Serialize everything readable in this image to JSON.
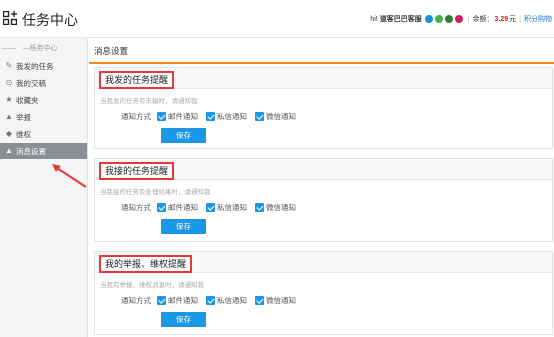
{
  "header": {
    "title": "任务中心",
    "greeting": "hi!",
    "username": "道客巴巴客服",
    "balance_label": "余额：",
    "balance_value": "3.29",
    "balance_unit": "元",
    "points_link": "积分购物",
    "social_icons": [
      {
        "name": "qq-icon",
        "color": "#1a8fe0"
      },
      {
        "name": "wechat-icon",
        "color": "#3fb34f"
      },
      {
        "name": "phone-icon",
        "color": "#2e7d32"
      },
      {
        "name": "weibo-icon",
        "color": "#d81b60"
      }
    ]
  },
  "sidebar": {
    "heading": "任务中心",
    "items": [
      {
        "label": "我发的任务",
        "icon": "edit-icon"
      },
      {
        "label": "我的交稿",
        "icon": "upload-icon"
      },
      {
        "label": "收藏夹",
        "icon": "star-icon"
      },
      {
        "label": "举报",
        "icon": "alarm-icon"
      },
      {
        "label": "维权",
        "icon": "shield-icon"
      },
      {
        "label": "消息设置",
        "icon": "bell-icon",
        "active": true
      }
    ]
  },
  "main": {
    "title": "消息设置",
    "accent_color": "#f08a1c",
    "panels": [
      {
        "title": "我发的任务提醒",
        "desc": "当我发的任务有未稿时，请通知我",
        "method_label": "通知方式",
        "options": [
          "邮件通知",
          "私信通知",
          "微信通知"
        ],
        "save": "保存"
      },
      {
        "title": "我接的任务提醒",
        "desc": "当我接的任务有处理结果时，请通知我",
        "method_label": "通知方式",
        "options": [
          "邮件通知",
          "私信通知",
          "微信通知"
        ],
        "save": "保存"
      },
      {
        "title": "我的举报、维权提醒",
        "desc": "当我有举报、维权消息时，请通知我",
        "method_label": "通知方式",
        "options": [
          "邮件通知",
          "私信通知",
          "微信通知"
        ],
        "save": "保存"
      }
    ]
  }
}
